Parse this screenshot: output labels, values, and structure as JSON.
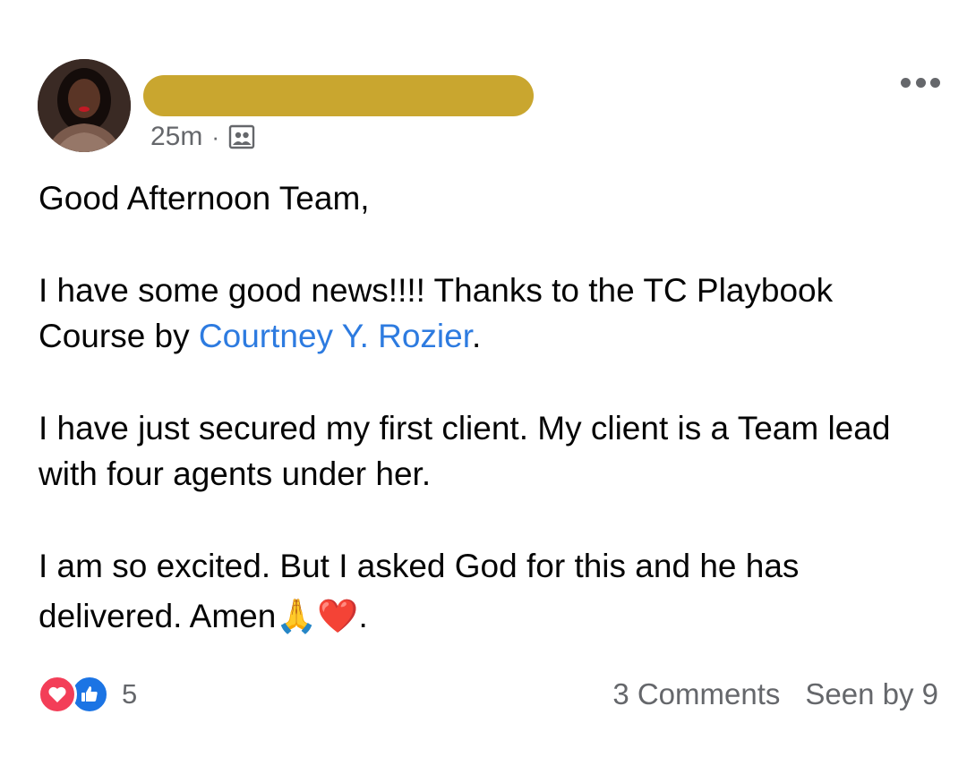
{
  "post": {
    "timestamp": "25m",
    "separator": "·",
    "audience_icon": "group-audience-icon",
    "more_icon": "more-options-icon",
    "paragraphs": {
      "p1": "Good Afternoon Team,",
      "p2_before": "I have some good news!!!! Thanks to the TC Playbook Course by ",
      "p2_link": "Courtney Y. Rozier",
      "p2_after": ".",
      "p3": "I have just secured my first client. My client is a Team lead with four agents under her.",
      "p4_line1": "I am so excited. But I asked God for this and he has",
      "p4_line2_text": "delivered. Amen",
      "p4_emoji_pray": "🙏",
      "p4_emoji_heart": "❤️",
      "p4_end": "."
    }
  },
  "footer": {
    "reaction_icons": [
      "heart-reaction-icon",
      "like-reaction-icon"
    ],
    "reaction_count": "5",
    "comments": "3 Comments",
    "seen_by": "Seen by 9"
  },
  "colors": {
    "name_redaction": "#c9a62f",
    "link": "#2d7be0",
    "secondary_text": "#65676b",
    "heart": "#f33e58",
    "like": "#1b74e4"
  }
}
